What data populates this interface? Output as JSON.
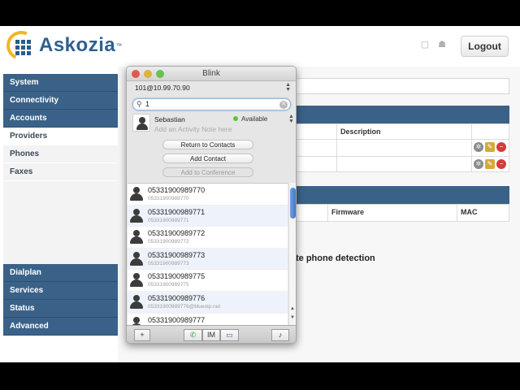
{
  "app": {
    "logo_text": "Askozia",
    "logo_mark": "™",
    "logout_label": "Logout",
    "top_icons": [
      "page-icon",
      "user-icon"
    ]
  },
  "sidebar": {
    "items": [
      {
        "label": "System",
        "type": "section"
      },
      {
        "label": "Connectivity",
        "type": "section"
      },
      {
        "label": "Accounts",
        "type": "section"
      },
      {
        "label": "Providers",
        "type": "sub"
      },
      {
        "label": "Phones",
        "type": "sub"
      },
      {
        "label": "Faxes",
        "type": "sub"
      },
      {
        "label": "Dialplan",
        "type": "section"
      },
      {
        "label": "Services",
        "type": "section"
      },
      {
        "label": "Status",
        "type": "section"
      },
      {
        "label": "Advanced",
        "type": "section"
      }
    ]
  },
  "content": {
    "providers_table": {
      "header_description": "Description"
    },
    "phones_table": {
      "header_firmware": "Firmware",
      "header_mac": "MAC",
      "detect_button": "te phone detection"
    }
  },
  "blink": {
    "title": "Blink",
    "account": "101@10.99.70.90",
    "search": {
      "value": "1"
    },
    "me": {
      "name": "Sebastian",
      "note_placeholder": "Add an Activity Note here",
      "status": "Available"
    },
    "actions": {
      "return_to_contacts": "Return to Contacts",
      "add_contact": "Add Contact",
      "add_to_conference": "Add to Conference"
    },
    "contacts": [
      {
        "name": "05331900989770",
        "uri": "05331900989770"
      },
      {
        "name": "05331900989771",
        "uri": "05331900989771"
      },
      {
        "name": "05331900989772",
        "uri": "05331900989772"
      },
      {
        "name": "05331900989773",
        "uri": "05331900989773"
      },
      {
        "name": "05331900989775",
        "uri": "05331900989775"
      },
      {
        "name": "05331900989776",
        "uri": "05331900989776@blueoip.net"
      },
      {
        "name": "05331900989777",
        "uri": ""
      }
    ],
    "bottom": {
      "add": "+",
      "im": "IM"
    }
  }
}
